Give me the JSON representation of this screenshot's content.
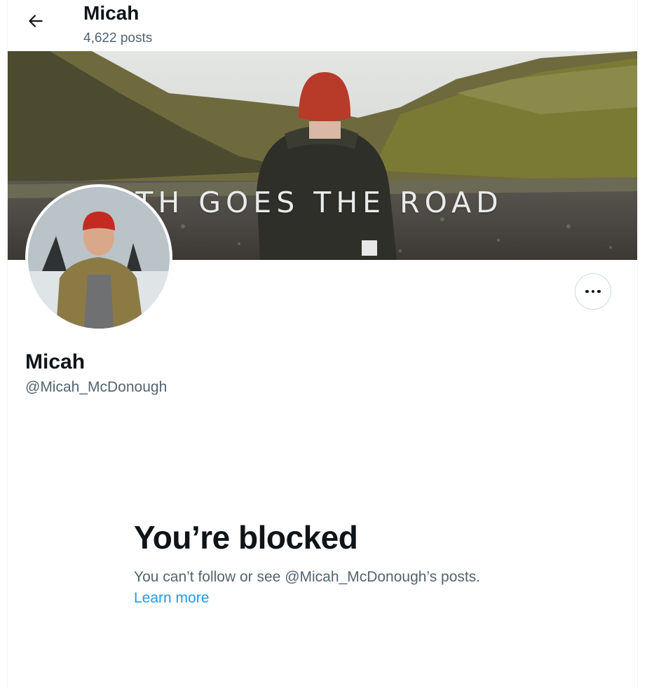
{
  "header": {
    "back_icon": "arrow-left-icon",
    "name": "Micah",
    "post_count": "4,622 posts"
  },
  "banner": {
    "text": "FORTH GOES THE ROAD"
  },
  "profile": {
    "display_name": "Micah",
    "handle": "@Micah_McDonough",
    "more_icon": "more-horizontal-icon"
  },
  "blocked": {
    "title": "You’re blocked",
    "message": "You can’t follow or see @Micah_McDonough’s posts.",
    "link_label": "Learn more"
  },
  "colors": {
    "text_primary": "#0f1419",
    "text_secondary": "#536471",
    "link": "#1d9bf0",
    "border": "#cfd9de"
  }
}
